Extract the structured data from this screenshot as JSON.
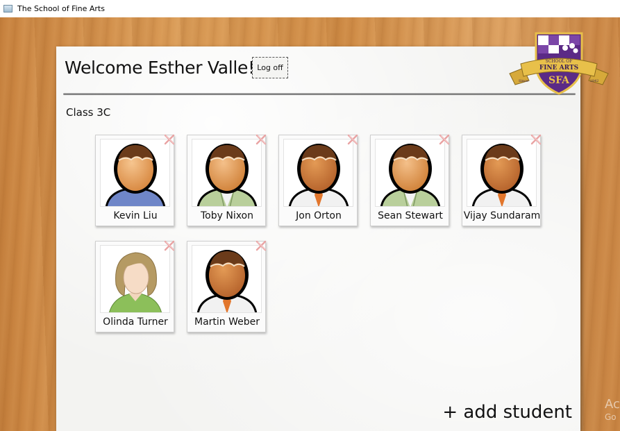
{
  "window": {
    "title": "The School of Fine Arts"
  },
  "header": {
    "welcome_text": "Welcome Esther Valle!",
    "logoff_label": "Log off"
  },
  "crest": {
    "line1": "SCHOOL OF",
    "line2": "FINE ARTS",
    "monogram": "SFA",
    "year_left": "Since",
    "year_right": "1842"
  },
  "class_label": "Class 3C",
  "students": [
    {
      "name": "Kevin Liu",
      "avatar": "male-blue-sweater-icon"
    },
    {
      "name": "Toby Nixon",
      "avatar": "male-green-jacket-icon"
    },
    {
      "name": "Jon Orton",
      "avatar": "male-white-shirt-orange-tie-icon"
    },
    {
      "name": "Sean Stewart",
      "avatar": "male-green-jacket-icon"
    },
    {
      "name": "Vijay Sundaram",
      "avatar": "male-white-shirt-orange-tie-icon"
    },
    {
      "name": "Olinda Turner",
      "avatar": "female-green-top-icon"
    },
    {
      "name": "Martin Weber",
      "avatar": "male-white-shirt-orange-tie-icon"
    }
  ],
  "add_student_label": "+ add student",
  "watermark": {
    "line1": "Ac",
    "line2": "Go"
  },
  "colors": {
    "crest_purple": "#5b2a86",
    "crest_gold": "#e8c04a",
    "remove_x": "#e9a3a3"
  }
}
